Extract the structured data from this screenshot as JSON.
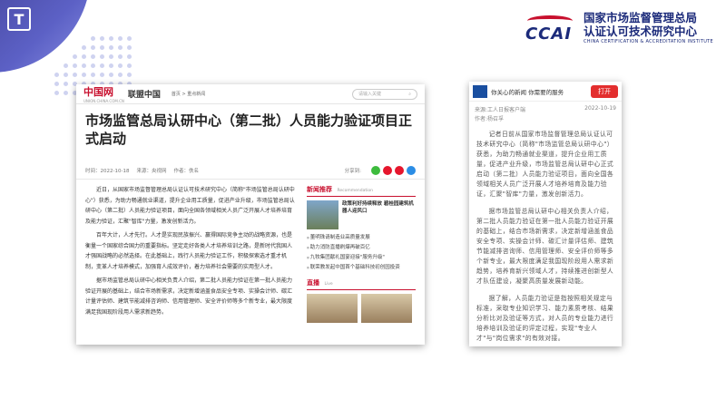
{
  "brand": {
    "logo_text": "CCAI",
    "name_line1": "国家市场监督管理总局",
    "name_line2": "认证认可技术研究中心",
    "name_en": "CHINA CERTIFICATION & ACCREDITATION INSTITUTE"
  },
  "corner_icon": "T",
  "left": {
    "logo": "中国网",
    "logo_sub": "UNION.CHINA.COM.CN",
    "site": "联盟中国",
    "nav": "首页 > 重点新闻",
    "search_placeholder": "请输入关键",
    "title": "市场监管总局认研中心（第二批）人员能力验证项目正式启动",
    "time": "时间：2022-10-18",
    "source": "来源：央视网",
    "author": "作者：佚名",
    "share_label": "分享到:",
    "paragraphs": [
      "近日，从国家市场监督管理总局认证认可技术研究中心（简称\"市场监管总局认研中心\"）获悉，为助力畅通就业渠道，提升企业用工质量，促进产业升级，市场监管总局认研中心（第二批）人员能力验证项目，面向全国各领域相关人员广泛开展人才培养培育及能力验证，汇聚\"智库\"力量，激发创新活力。",
      "百年大计，人才先行。人才是实现民族振兴、赢得国际竞争主动的战略资源，也是衡量一个国家综合国力的重要指标。坚定走好各类人才培养培训之路，是新时代我国人才强国战略的必然选择。在此基础上，践行人员能力验证工作，积极探索选才重才机制，变革人才培养模式，加强育人成效评价，着力培养社会需要的实用型人才。",
      "据市场监管总局认研中心相关负责人介绍，第二批人员能力验证在第一批人员能力验证开展的基础上，结合市场新需求，决定新增涵盖食品安全专项、实操会计师、碳汇计量评估师、建筑节能减排咨询师、信用管理师、安全评价师等多个新专业，最大限度满足我国现阶段用人需求新趋势。"
    ],
    "side_header": "新闻推荐",
    "side_header_en": "Recommendation",
    "feature_caption": "政策利好持续释放 碧桂园建筑机器人迎风口",
    "links": [
      "董明珠请制造业高质量发展",
      "助力消防直播刷爆再破百亿",
      "九牧集团献礼国宴迎接\"服务升级\"",
      "联荣教发起中国首个基础科技初创园投资"
    ],
    "live_header": "直播",
    "live_header_en": "Live"
  },
  "right": {
    "banner_tag": "你关心的新闻 你需要的服务",
    "open_button": "打开",
    "source": "来源:工人日报客户端",
    "date": "2022-10-19",
    "author": "作者:杨召孚",
    "paragraphs": [
      "记者日前从国家市场监督管理总局认证认可技术研究中心（简称\"市场监管总局认研中心\"）获悉，为助力畅通就业渠道，提升企业用工质量，促进产业升级，市场监管总局认研中心正式启动（第二批）人员能力验证项目，面向全国各领域相关人员广泛开展人才培养培育及能力验证，汇聚\"智库\"力量，激发创新活力。",
      "据市场监管总局认研中心相关负责人介绍，第二批人员能力验证在第一批人员能力验证开展的基础上，结合市场新需求，决定新增涵盖食品安全专项、实操会计师、碳汇计量评估师、建筑节能减排咨询师、信用管理师、安全评价师等多个新专业，最大限度满足我国现阶段用人需求新趋势，培养育新兴领域人才，持续推进创新型人才队伍建设，凝聚高质量发展新动能。",
      "据了解，人员能力验证是指按照相关规定与标准，采取专业知识学习、能力素质考核、结果分析比对及验证等方式，对人员的专业能力进行培养培训及验证的评定过程，实现\"专业人才\"与\"岗位需求\"的有效对接。"
    ]
  },
  "colors": {
    "accent_red": "#c8102e",
    "brand_blue": "#1b2a7a",
    "open_red": "#e32e2e"
  }
}
